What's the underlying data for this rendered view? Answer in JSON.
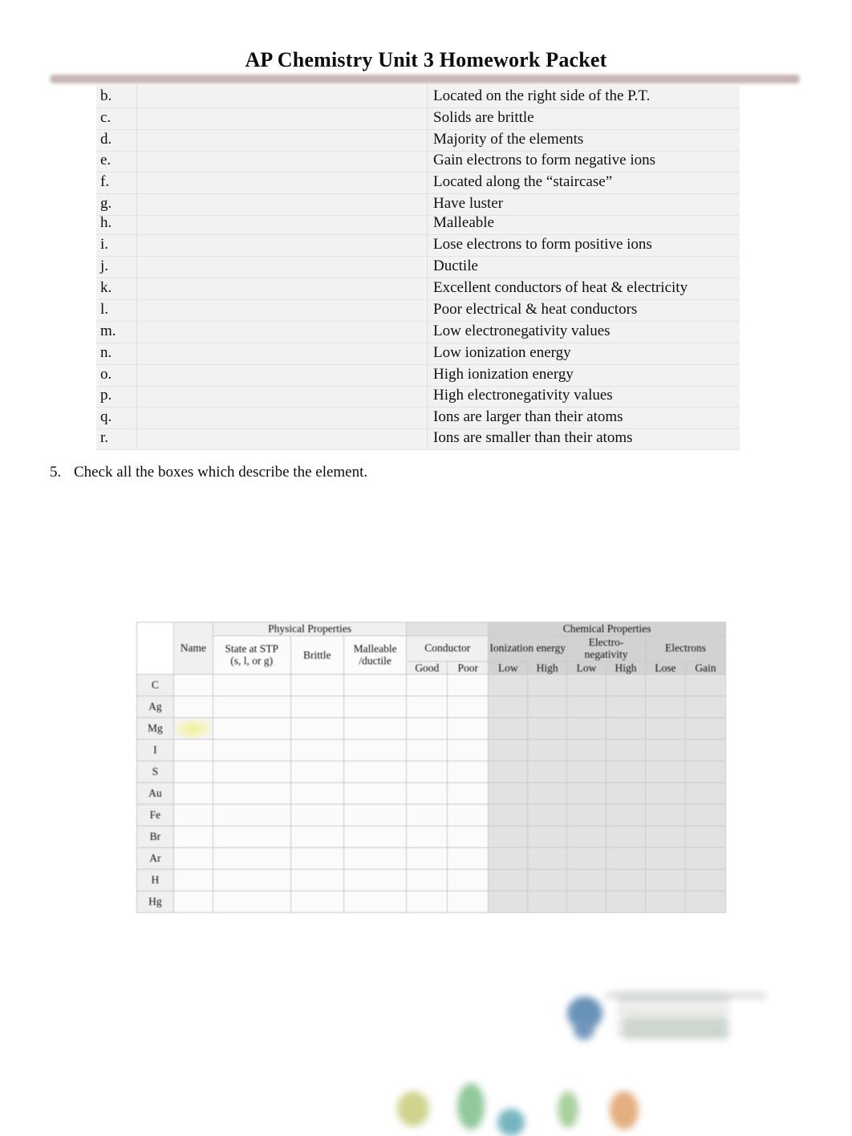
{
  "document": {
    "title": "AP Chemistry Unit 3 Homework Packet"
  },
  "properties_list": {
    "items": [
      {
        "letter": "b.",
        "text": "Located on the right side of the P.T."
      },
      {
        "letter": "c.",
        "text": "Solids are brittle"
      },
      {
        "letter": "d.",
        "text": "Majority of the elements"
      },
      {
        "letter": "e.",
        "text": "Gain electrons to form negative ions"
      },
      {
        "letter": "f.",
        "text": "Located along the “staircase”"
      },
      {
        "letter": "g.",
        "text": "Have luster"
      },
      {
        "letter": "h.",
        "text": "Malleable"
      },
      {
        "letter": "i.",
        "text": "Lose electrons to form positive ions"
      },
      {
        "letter": "j.",
        "text": "Ductile"
      },
      {
        "letter": "k.",
        "text": "Excellent conductors of heat & electricity"
      },
      {
        "letter": "l.",
        "text": "Poor electrical & heat conductors"
      },
      {
        "letter": "m.",
        "text": "Low electronegativity values"
      },
      {
        "letter": "n.",
        "text": "Low ionization energy"
      },
      {
        "letter": "o.",
        "text": "High ionization energy"
      },
      {
        "letter": "p.",
        "text": "High electronegativity values"
      },
      {
        "letter": "q.",
        "text": "Ions are larger than their atoms"
      },
      {
        "letter": "r.",
        "text": "Ions are smaller than their atoms"
      }
    ]
  },
  "question5": {
    "number": "5.",
    "text": "Check all the boxes which describe the element."
  },
  "element_table": {
    "group_headers": {
      "physical": "Physical Properties",
      "chemical": "Chemical Properties"
    },
    "sub_group_headers": {
      "name": "Name",
      "state": "State at STP (s, l, or g)",
      "state_line1": "State at STP",
      "state_line2": "(s, l, or g)",
      "brittle": "Brittle",
      "malleable": "Malleable /ductile",
      "malleable_line1": "Malleable",
      "malleable_line2": "/ductile",
      "conductor": "Conductor",
      "ionization": "Ionization energy",
      "electronegativity": "Electro-negativity",
      "electrons": "Electrons"
    },
    "leaf_headers": {
      "good": "Good",
      "poor": "Poor",
      "ion_low": "Low",
      "ion_high": "High",
      "en_low": "Low",
      "en_high": "High",
      "lose": "Lose",
      "gain": "Gain"
    },
    "rows": [
      {
        "symbol": "C",
        "name": "",
        "state": "",
        "brittle": "",
        "malleable": "",
        "good": "",
        "poor": "",
        "ion_low": "",
        "ion_high": "",
        "en_low": "",
        "en_high": "",
        "lose": "",
        "gain": ""
      },
      {
        "symbol": "Ag",
        "name": "",
        "state": "",
        "brittle": "",
        "malleable": "",
        "good": "",
        "poor": "",
        "ion_low": "",
        "ion_high": "",
        "en_low": "",
        "en_high": "",
        "lose": "",
        "gain": ""
      },
      {
        "symbol": "Mg",
        "name": "",
        "state": "",
        "brittle": "",
        "malleable": "",
        "good": "",
        "poor": "",
        "ion_low": "",
        "ion_high": "",
        "en_low": "",
        "en_high": "",
        "lose": "",
        "gain": ""
      },
      {
        "symbol": "I",
        "name": "",
        "state": "",
        "brittle": "",
        "malleable": "",
        "good": "",
        "poor": "",
        "ion_low": "",
        "ion_high": "",
        "en_low": "",
        "en_high": "",
        "lose": "",
        "gain": ""
      },
      {
        "symbol": "S",
        "name": "",
        "state": "",
        "brittle": "",
        "malleable": "",
        "good": "",
        "poor": "",
        "ion_low": "",
        "ion_high": "",
        "en_low": "",
        "en_high": "",
        "lose": "",
        "gain": ""
      },
      {
        "symbol": "Au",
        "name": "",
        "state": "",
        "brittle": "",
        "malleable": "",
        "good": "",
        "poor": "",
        "ion_low": "",
        "ion_high": "",
        "en_low": "",
        "en_high": "",
        "lose": "",
        "gain": ""
      },
      {
        "symbol": "Fe",
        "name": "",
        "state": "",
        "brittle": "",
        "malleable": "",
        "good": "",
        "poor": "",
        "ion_low": "",
        "ion_high": "",
        "en_low": "",
        "en_high": "",
        "lose": "",
        "gain": ""
      },
      {
        "symbol": "Br",
        "name": "",
        "state": "",
        "brittle": "",
        "malleable": "",
        "good": "",
        "poor": "",
        "ion_low": "",
        "ion_high": "",
        "en_low": "",
        "en_high": "",
        "lose": "",
        "gain": ""
      },
      {
        "symbol": "Ar",
        "name": "",
        "state": "",
        "brittle": "",
        "malleable": "",
        "good": "",
        "poor": "",
        "ion_low": "",
        "ion_high": "",
        "en_low": "",
        "en_high": "",
        "lose": "",
        "gain": ""
      },
      {
        "symbol": "H",
        "name": "",
        "state": "",
        "brittle": "",
        "malleable": "",
        "good": "",
        "poor": "",
        "ion_low": "",
        "ion_high": "",
        "en_low": "",
        "en_high": "",
        "lose": "",
        "gain": ""
      },
      {
        "symbol": "Hg",
        "name": "",
        "state": "",
        "brittle": "",
        "malleable": "",
        "good": "",
        "poor": "",
        "ion_low": "",
        "ion_high": "",
        "en_low": "",
        "en_high": "",
        "lose": "",
        "gain": ""
      }
    ]
  },
  "colors": {
    "title_rule": "#c2afae",
    "table_bg": "#f2f2f2",
    "header_shade_light": "#f0f0f0",
    "header_shade_mid": "#e2e2e2",
    "header_shade_dark": "#d2d2d2",
    "highlight_yellow": "#efef9c"
  }
}
